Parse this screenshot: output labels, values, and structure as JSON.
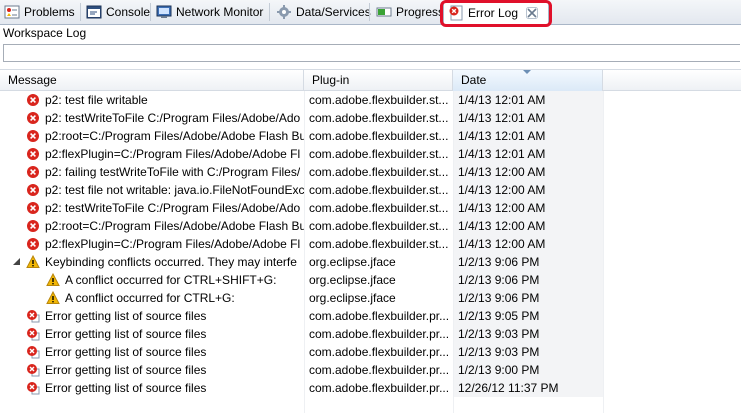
{
  "tabs": [
    {
      "label": "Problems",
      "icon": "problems-icon"
    },
    {
      "label": "Console",
      "icon": "console-icon"
    },
    {
      "label": "Network Monitor",
      "icon": "network-monitor-icon"
    },
    {
      "label": "Data/Services",
      "icon": "data-services-icon"
    },
    {
      "label": "Progress",
      "icon": "progress-icon"
    },
    {
      "label": "Error Log",
      "icon": "error-log-icon",
      "active": true
    }
  ],
  "workspace_title": "Workspace Log",
  "filter": {
    "value": "",
    "placeholder": ""
  },
  "columns": {
    "message": "Message",
    "plugin": "Plug-in",
    "date": "Date"
  },
  "rows": [
    {
      "severity": "error",
      "message": "p2: test file writable",
      "plugin": "com.adobe.flexbuilder.st...",
      "date": "1/4/13 12:01 AM"
    },
    {
      "severity": "error",
      "message": "p2: testWriteToFile C:/Program Files/Adobe/Ado",
      "plugin": "com.adobe.flexbuilder.st...",
      "date": "1/4/13 12:01 AM"
    },
    {
      "severity": "error",
      "message": "p2:root=C:/Program Files/Adobe/Adobe Flash Bu",
      "plugin": "com.adobe.flexbuilder.st...",
      "date": "1/4/13 12:01 AM"
    },
    {
      "severity": "error",
      "message": "p2:flexPlugin=C:/Program Files/Adobe/Adobe Fl",
      "plugin": "com.adobe.flexbuilder.st...",
      "date": "1/4/13 12:01 AM"
    },
    {
      "severity": "error",
      "message": "p2: failing testWriteToFile with C:/Program Files/",
      "plugin": "com.adobe.flexbuilder.st...",
      "date": "1/4/13 12:00 AM"
    },
    {
      "severity": "error",
      "message": "p2: test file not writable: java.io.FileNotFoundExc",
      "plugin": "com.adobe.flexbuilder.st...",
      "date": "1/4/13 12:00 AM"
    },
    {
      "severity": "error",
      "message": "p2: testWriteToFile C:/Program Files/Adobe/Ado",
      "plugin": "com.adobe.flexbuilder.st...",
      "date": "1/4/13 12:00 AM"
    },
    {
      "severity": "error",
      "message": "p2:root=C:/Program Files/Adobe/Adobe Flash Bu",
      "plugin": "com.adobe.flexbuilder.st...",
      "date": "1/4/13 12:00 AM"
    },
    {
      "severity": "error",
      "message": "p2:flexPlugin=C:/Program Files/Adobe/Adobe Fl",
      "plugin": "com.adobe.flexbuilder.st...",
      "date": "1/4/13 12:00 AM"
    },
    {
      "severity": "warning",
      "expanded": true,
      "message": "Keybinding conflicts occurred.  They may interfe",
      "plugin": "org.eclipse.jface",
      "date": "1/2/13 9:06 PM"
    },
    {
      "severity": "warning",
      "child": true,
      "message": "A conflict occurred for CTRL+SHIFT+G:",
      "plugin": "org.eclipse.jface",
      "date": "1/2/13 9:06 PM"
    },
    {
      "severity": "warning",
      "child": true,
      "message": "A conflict occurred for CTRL+G:",
      "plugin": "org.eclipse.jface",
      "date": "1/2/13 9:06 PM"
    },
    {
      "severity": "error-stack",
      "message": "Error getting list of source files",
      "plugin": "com.adobe.flexbuilder.pr...",
      "date": "1/2/13 9:05 PM"
    },
    {
      "severity": "error-stack",
      "message": "Error getting list of source files",
      "plugin": "com.adobe.flexbuilder.pr...",
      "date": "1/2/13 9:03 PM"
    },
    {
      "severity": "error-stack",
      "message": "Error getting list of source files",
      "plugin": "com.adobe.flexbuilder.pr...",
      "date": "1/2/13 9:03 PM"
    },
    {
      "severity": "error-stack",
      "message": "Error getting list of source files",
      "plugin": "com.adobe.flexbuilder.pr...",
      "date": "1/2/13 9:00 PM"
    },
    {
      "severity": "error-stack",
      "message": "Error getting list of source files",
      "plugin": "com.adobe.flexbuilder.pr...",
      "date": "12/26/12 11:37 PM"
    }
  ],
  "colors": {
    "highlight": "#e0102a",
    "error": "#d9251d",
    "warning": "#f2b705"
  }
}
